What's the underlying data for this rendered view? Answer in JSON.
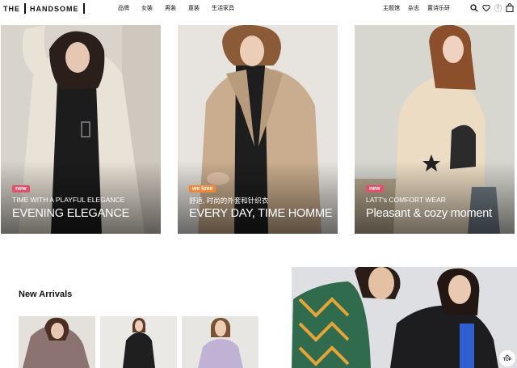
{
  "header": {
    "logo_left": "THE",
    "logo_right": "HANDSOME",
    "nav": [
      "品牌",
      "女裝",
      "男裝",
      "童裝",
      "生活家具"
    ],
    "utility_links": [
      "主题馆",
      "杂志",
      "置诗乐研"
    ],
    "icons": [
      "search-icon",
      "heart-icon",
      "bag-icon"
    ],
    "heart_count": "0",
    "bag_count": "0"
  },
  "hero": [
    {
      "badge": "new",
      "subtitle": "TIME WITH A PLAYFUL ELEGANCE",
      "headline": "EVENING ELEGANCE"
    },
    {
      "badge": "we love",
      "subtitle": "舒适, 时尚的外套和针织衣",
      "headline": "EVERY DAY, TIME HOMME"
    },
    {
      "badge": "new",
      "subtitle": "LATT's COMFORT WEAR",
      "headline": "Pleasant & cozy moment"
    }
  ],
  "new_arrivals": {
    "title": "New Arrivals"
  },
  "top_button": {
    "label": "TOP"
  },
  "colors": {
    "badge_new": "#e0506b",
    "badge_love": "#ef8a3a"
  }
}
